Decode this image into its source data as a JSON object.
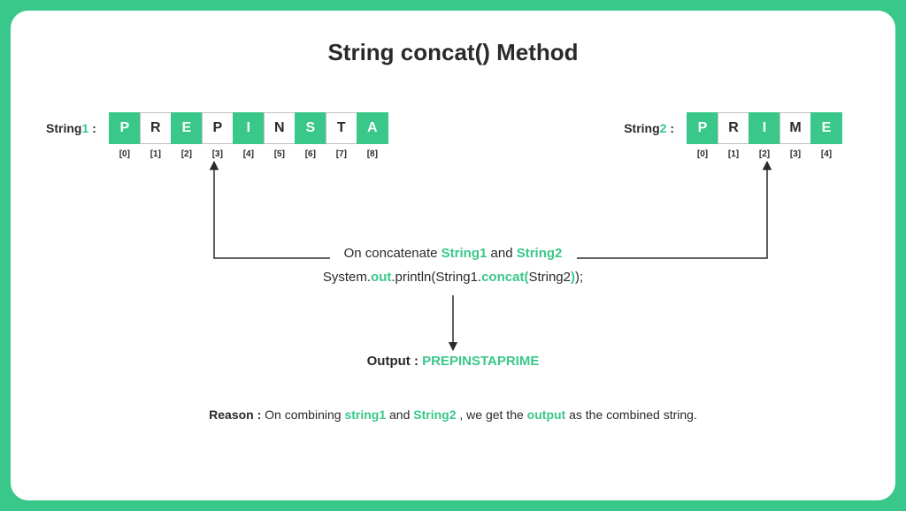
{
  "title": "String concat() Method",
  "string1": {
    "label_text": "String",
    "label_num": "1",
    "label_colon": " :",
    "chars": [
      "P",
      "R",
      "E",
      "P",
      "I",
      "N",
      "S",
      "T",
      "A"
    ],
    "indices": [
      "[0]",
      "[1]",
      "[2]",
      "[3]",
      "[4]",
      "[5]",
      "[6]",
      "[7]",
      "[8]"
    ]
  },
  "string2": {
    "label_text": "String",
    "label_num": "2",
    "label_colon": " :",
    "chars": [
      "P",
      "R",
      "I",
      "M",
      "E"
    ],
    "indices": [
      "[0]",
      "[1]",
      "[2]",
      "[3]",
      "[4]"
    ]
  },
  "concat_text": {
    "pre": "On concatenate  ",
    "s1": "String1",
    "mid": " and  ",
    "s2": "String2"
  },
  "code": {
    "p1": "System.",
    "p2": "out",
    "p3": ".println(String1.",
    "p4": "concat(",
    "p5": "String2",
    "p6": ")",
    "p7": ");"
  },
  "output": {
    "label": "Output :  ",
    "value": "PREPINSTAPRIME"
  },
  "reason": {
    "label": "Reason :  ",
    "p1": "On combining ",
    "s1": "string1",
    "p2": " and ",
    "s2": "String2",
    "p3": " , we get the ",
    "s3": "output",
    "p4": " as the combined string."
  }
}
